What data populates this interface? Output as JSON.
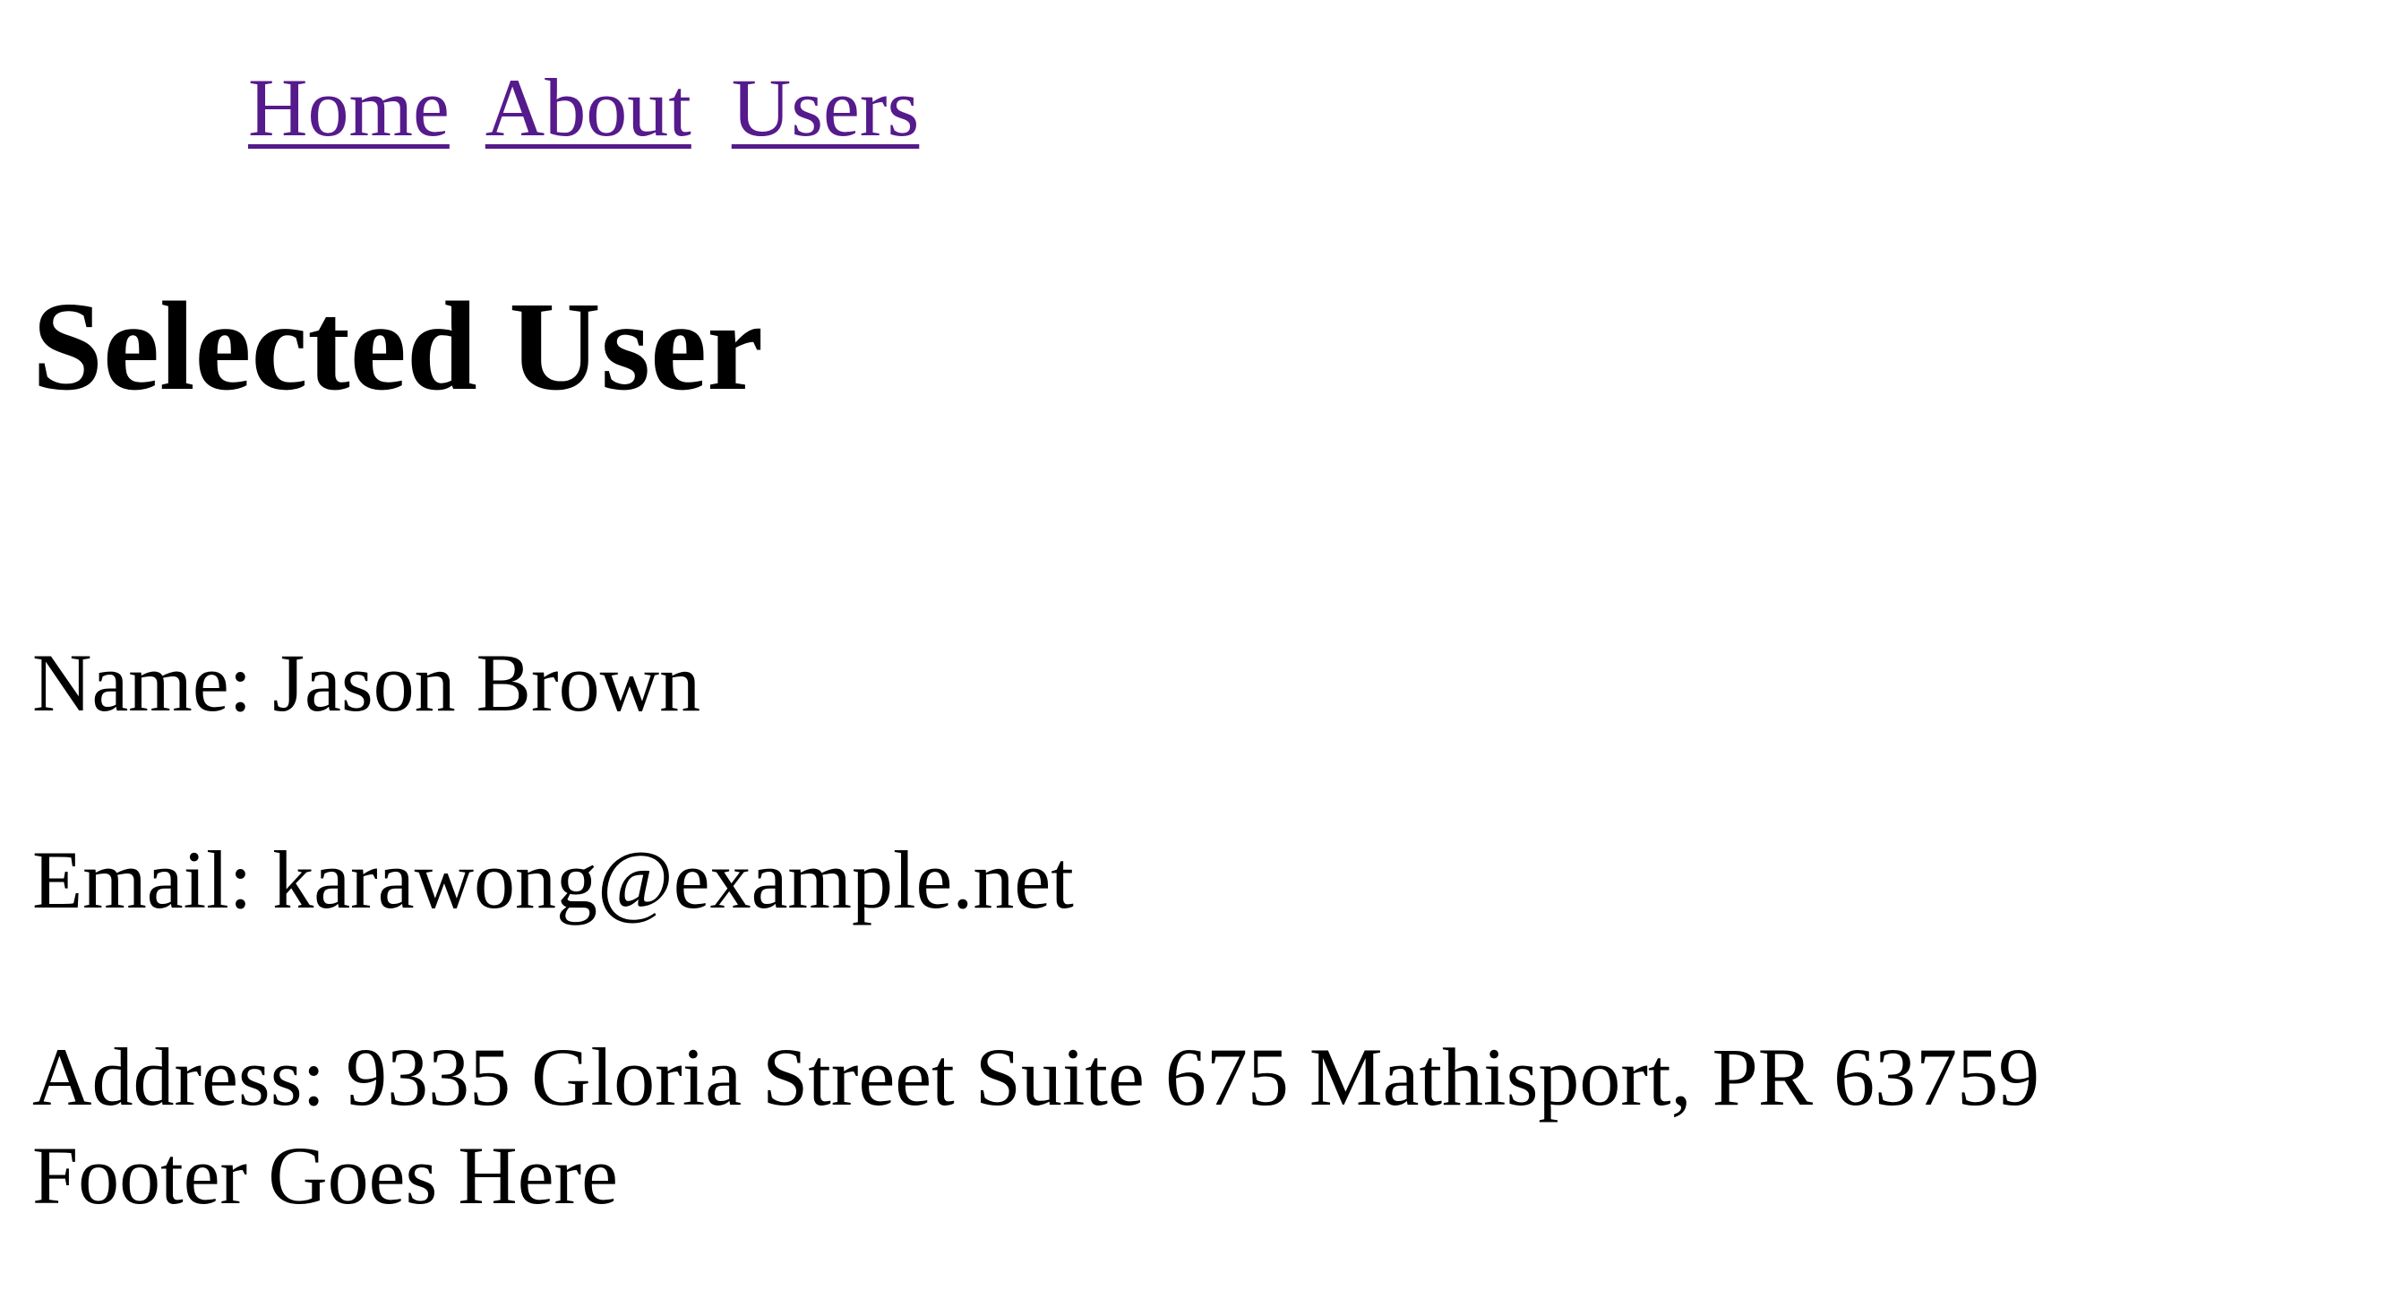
{
  "nav": {
    "links": [
      {
        "label": "Home"
      },
      {
        "label": "About"
      },
      {
        "label": "Users"
      }
    ]
  },
  "main": {
    "title": "Selected User",
    "name_line": "Name: Jason Brown",
    "email_line": "Email: karawong@example.net",
    "address_line": "Address: 9335 Gloria Street Suite 675 Mathisport, PR 63759"
  },
  "footer": {
    "text": "Footer Goes Here"
  },
  "colors": {
    "link": "#551a8b",
    "text": "#000000",
    "background": "#ffffff"
  }
}
